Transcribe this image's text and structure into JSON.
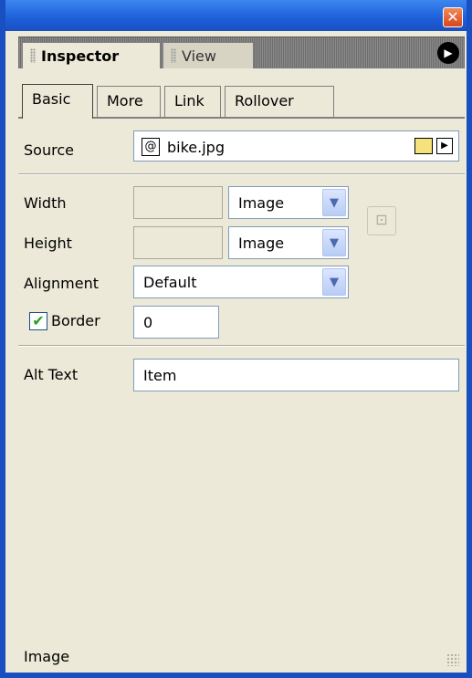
{
  "panel_tabs": [
    {
      "label": "Inspector",
      "active": true
    },
    {
      "label": "View",
      "active": false
    }
  ],
  "inner_tabs": [
    {
      "label": "Basic",
      "active": true
    },
    {
      "label": "More",
      "active": false
    },
    {
      "label": "Link",
      "active": false
    },
    {
      "label": "Rollover",
      "active": false
    }
  ],
  "source": {
    "label": "Source",
    "value": "bike.jpg"
  },
  "width": {
    "label": "Width",
    "value": "",
    "unit": "Image"
  },
  "height": {
    "label": "Height",
    "value": "",
    "unit": "Image"
  },
  "alignment": {
    "label": "Alignment",
    "value": "Default"
  },
  "border": {
    "label": "Border",
    "checked": true,
    "value": "0"
  },
  "alt_text": {
    "label": "Alt Text",
    "value": "Item"
  },
  "status": {
    "text": "Image"
  },
  "colors": {
    "title_blue": "#1a4fc2",
    "panel_bg": "#ece9d8",
    "close_red": "#d8451a"
  },
  "icons": [
    "close-icon",
    "options-arrow-icon",
    "source-file-icon",
    "folder-icon",
    "browse-arrow-icon",
    "constrain-icon",
    "checkmark-icon",
    "dropdown-chevron-icon",
    "resize-grip-icon"
  ]
}
